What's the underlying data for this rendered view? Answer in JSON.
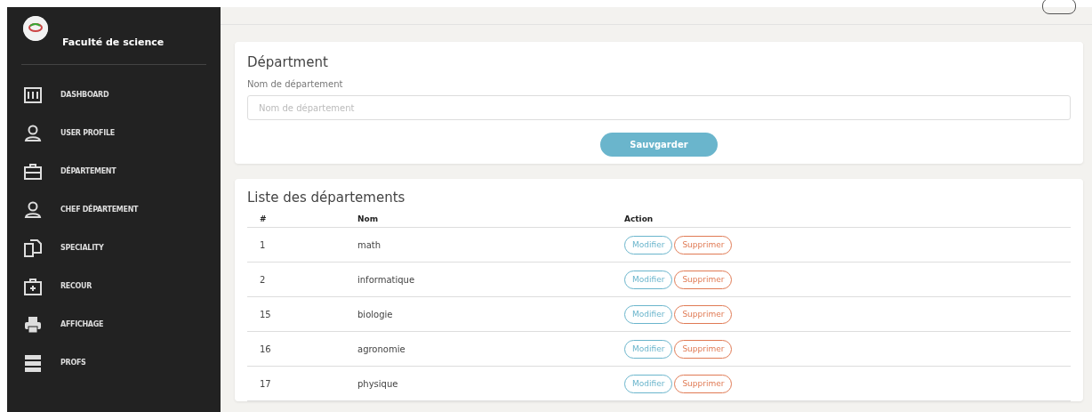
{
  "sidebar": {
    "brand": "Faculté de science",
    "items": [
      {
        "label": "DASHBOARD"
      },
      {
        "label": "USER PROFILE"
      },
      {
        "label": "DÉPARTEMENT"
      },
      {
        "label": "CHEF DÉPARTEMENT"
      },
      {
        "label": "SPECIALITY"
      },
      {
        "label": "RECOUR"
      },
      {
        "label": "AFFICHAGE"
      },
      {
        "label": "PROFS"
      }
    ]
  },
  "form": {
    "title": "Départment",
    "label": "Nom de département",
    "placeholder": "Nom de département",
    "button": "Sauvgarder"
  },
  "table": {
    "title": "Liste des départements",
    "columns": [
      "#",
      "Nom",
      "Action"
    ],
    "rows": [
      {
        "id": "1",
        "name": "math",
        "actions": [
          "Modifier",
          "Supprimer"
        ]
      },
      {
        "id": "2",
        "name": "informatique",
        "actions": [
          "Modifier",
          "Supprimer"
        ]
      },
      {
        "id": "15",
        "name": "biologie",
        "actions": [
          "Modifier",
          "Supprimer"
        ]
      },
      {
        "id": "16",
        "name": "agronomie",
        "actions": [
          "Modifier",
          "Supprimer"
        ]
      },
      {
        "id": "17",
        "name": "physique",
        "actions": [
          "Modifier",
          "Supprimer"
        ]
      }
    ]
  }
}
